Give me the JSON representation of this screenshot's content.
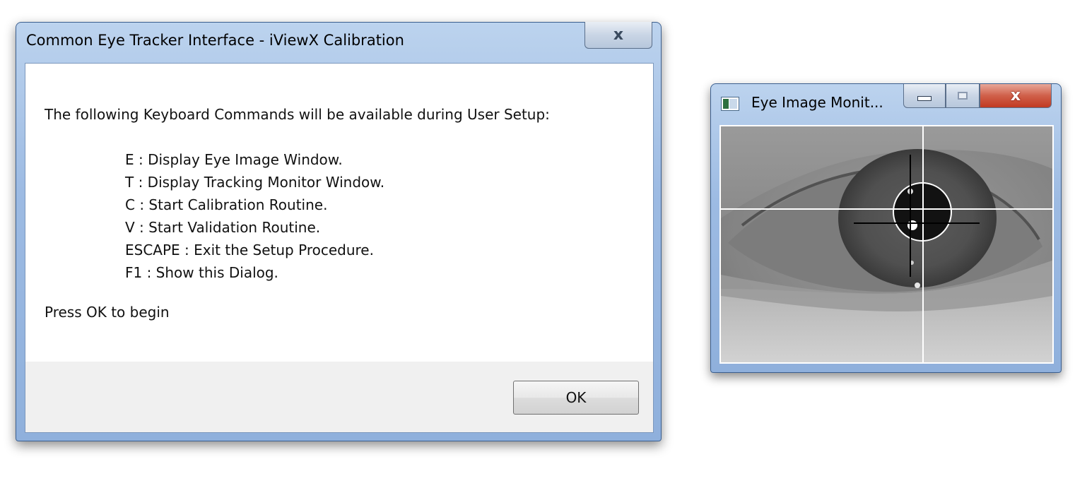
{
  "dialog": {
    "title": "Common Eye Tracker Interface - iViewX Calibration",
    "close_glyph": "x",
    "intro": "The following Keyboard Commands will be available during User Setup:",
    "commands": [
      "E : Display Eye Image Window.",
      "T : Display Tracking Monitor Window.",
      "C : Start Calibration Routine.",
      "V : Start Validation Routine.",
      "ESCAPE : Exit the Setup Procedure.",
      "F1 : Show this Dialog."
    ],
    "prompt": "Press OK to begin",
    "ok_label": "OK"
  },
  "monitor": {
    "title": "Eye Image Monit...",
    "close_glyph": "x",
    "icons": {
      "app": "window-app-icon",
      "minimize": "minimize-icon",
      "maximize": "maximize-icon",
      "close": "close-icon"
    },
    "image": "grayscale-eye-image-with-pupil-tracking-crosshair"
  },
  "colors": {
    "titlebar": "#9dbbe3",
    "close_active": "#c13a22",
    "footer": "#f0f0f0"
  }
}
